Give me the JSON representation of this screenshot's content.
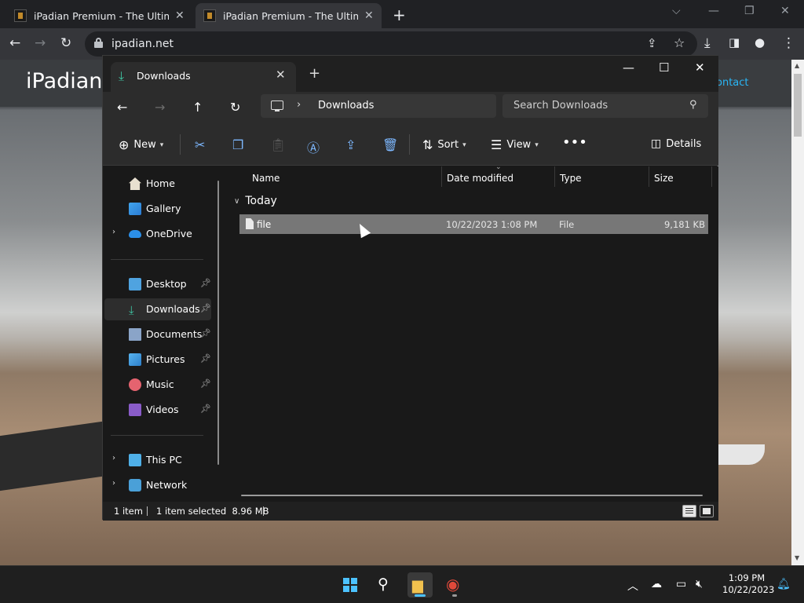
{
  "browser": {
    "tabs": [
      {
        "title": "iPadian Premium - The Ultimate"
      },
      {
        "title": "iPadian Premium - The Ultimate"
      }
    ],
    "url": "ipadian.net"
  },
  "website": {
    "logo": "iPadian",
    "nav_contact": "ontact"
  },
  "explorer": {
    "tab_title": "Downloads",
    "breadcrumb": "Downloads",
    "search_placeholder": "Search Downloads",
    "command_bar": {
      "new_label": "New",
      "sort_label": "Sort",
      "view_label": "View",
      "details_label": "Details"
    },
    "nav": {
      "quick": [
        {
          "label": "Home",
          "icon": "home-icon"
        },
        {
          "label": "Gallery",
          "icon": "gallery-icon"
        },
        {
          "label": "OneDrive",
          "icon": "onedrive-icon"
        }
      ],
      "pinned": [
        {
          "label": "Desktop",
          "icon": "desktop-icon"
        },
        {
          "label": "Downloads",
          "icon": "downloads-icon"
        },
        {
          "label": "Documents",
          "icon": "documents-icon"
        },
        {
          "label": "Pictures",
          "icon": "pictures-icon"
        },
        {
          "label": "Music",
          "icon": "music-icon"
        },
        {
          "label": "Videos",
          "icon": "videos-icon"
        }
      ],
      "devices": [
        {
          "label": "This PC",
          "icon": "this-pc-icon"
        },
        {
          "label": "Network",
          "icon": "network-icon"
        }
      ],
      "selected": "Downloads"
    },
    "columns": {
      "name": "Name",
      "date": "Date modified",
      "type": "Type",
      "size": "Size"
    },
    "group": "Today",
    "files": [
      {
        "name": "file",
        "date": "10/22/2023 1:08 PM",
        "type": "File",
        "size": "9,181 KB"
      }
    ],
    "status": {
      "count": "1 item",
      "selection": "1 item selected  8.96 MB"
    }
  },
  "taskbar": {
    "time": "1:09 PM",
    "date": "10/22/2023"
  },
  "colors": {
    "accent": "#4cc2ff",
    "downloads_green": "#3fc1a0",
    "selection_row": "#777777"
  }
}
